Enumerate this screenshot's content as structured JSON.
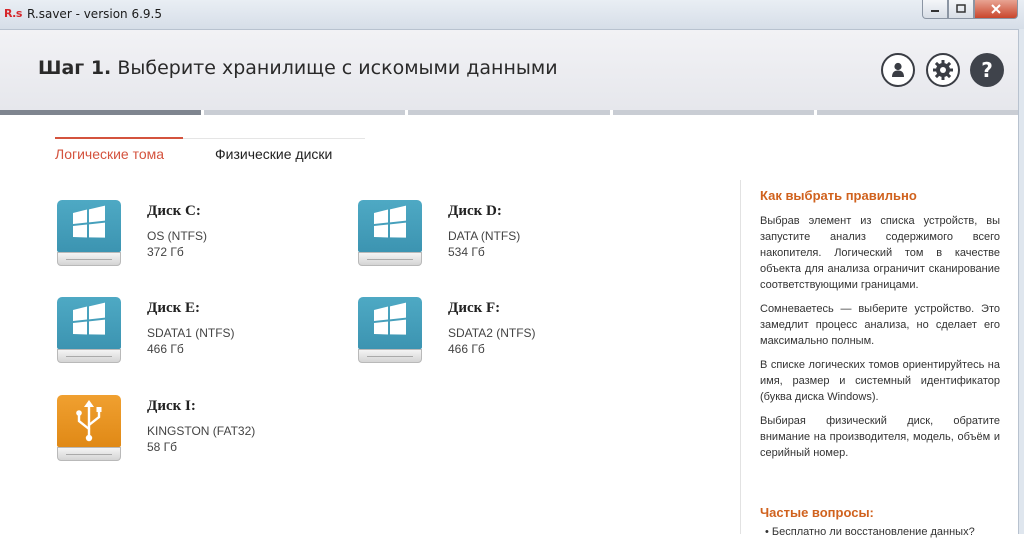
{
  "window": {
    "app_icon": "R.s",
    "title": "R.saver - version 6.9.5",
    "buttons": {
      "minimize": "minimize-icon",
      "maximize": "maximize-icon",
      "close": "close-icon"
    }
  },
  "header": {
    "step_label": "Шаг 1.",
    "step_text": "Выберите хранилище с искомыми данными",
    "help_glyph": "?"
  },
  "progress": {
    "current_step": 1,
    "total_steps": 5
  },
  "tabs": [
    {
      "label": "Логические тома",
      "active": true
    },
    {
      "label": "Физические диски",
      "active": false
    }
  ],
  "disks": [
    {
      "name": "Диск C:",
      "fs": "OS (NTFS)",
      "size": "372 Гб",
      "type": "windows"
    },
    {
      "name": "Диск D:",
      "fs": "DATA (NTFS)",
      "size": "534 Гб",
      "type": "windows"
    },
    {
      "name": "Диск E:",
      "fs": "SDATA1 (NTFS)",
      "size": "466 Гб",
      "type": "windows"
    },
    {
      "name": "Диск F:",
      "fs": "SDATA2 (NTFS)",
      "size": "466 Гб",
      "type": "windows"
    },
    {
      "name": "Диск I:",
      "fs": "KINGSTON (FAT32)",
      "size": "58 Гб",
      "type": "usb"
    }
  ],
  "sidebar": {
    "title": "Как выбрать правильно",
    "paragraphs": [
      "Выбрав элемент из списка устройств, вы запустите анализ содержимого всего накопителя. Логический том в качестве объекта для анализа ограничит сканирование соответствующими границами.",
      "Сомневаетесь — выберите устройство. Это замедлит процесс анализа, но сделает его максимально полным.",
      "В списке логических томов ориентируйтесь на имя, размер и системный идентификатор (буква диска Windows).",
      "Выбирая физический диск, обратите внимание на производителя, модель, объём и серийный номер."
    ],
    "faq_title": "Частые вопросы:",
    "faq_items": [
      "Бесплатно ли восстановление данных?"
    ]
  },
  "colors": {
    "accent": "#d4533e",
    "sidebar_title": "#d0621e",
    "windows_disk": "#3c94b1",
    "usb_disk": "#e08916"
  }
}
